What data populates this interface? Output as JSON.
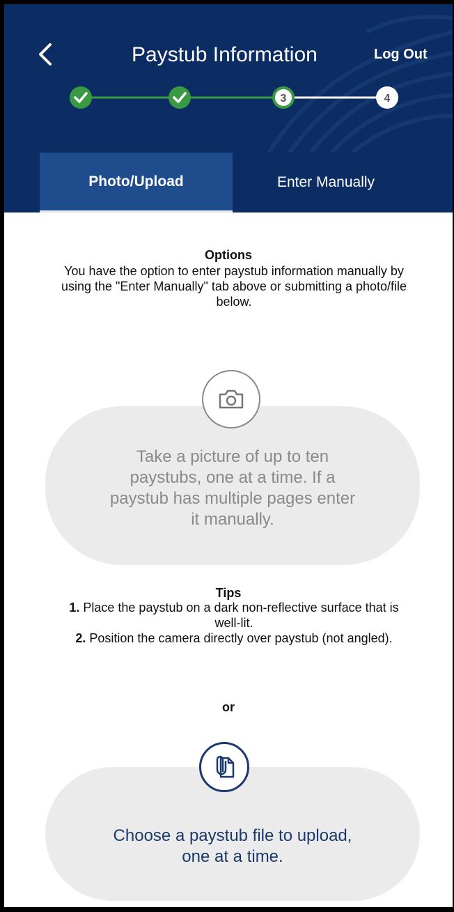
{
  "header": {
    "title": "Paystub Information",
    "logout_label": "Log Out",
    "back_icon": "chevron-left-icon"
  },
  "stepper": {
    "steps": [
      {
        "label": "",
        "status": "complete"
      },
      {
        "label": "",
        "status": "complete"
      },
      {
        "label": "3",
        "status": "current"
      },
      {
        "label": "4",
        "status": "upcoming"
      }
    ]
  },
  "tabs": [
    {
      "label": "Photo/Upload",
      "active": true
    },
    {
      "label": "Enter Manually",
      "active": false
    }
  ],
  "options": {
    "title": "Options",
    "text": "You have the option to enter paystub information manually by using the \"Enter Manually\" tab above or submitting a photo/file below."
  },
  "photo": {
    "icon": "camera-icon",
    "text": "Take a picture of up to ten paystubs, one at a time. If a paystub has multiple pages enter it manually."
  },
  "tips": {
    "title": "Tips",
    "items": [
      {
        "number": "1.",
        "text": " Place the paystub on a dark non-reflective surface that is well-lit."
      },
      {
        "number": "2.",
        "text": " Position the camera directly over paystub (not angled)."
      }
    ]
  },
  "or_label": "or",
  "upload": {
    "icon": "paperclip-file-icon",
    "text": "Choose a paystub file to upload, one at a time."
  },
  "colors": {
    "header_bg": "#0b2d63",
    "active_tab": "#1e4c8c",
    "step_complete": "#3a9a44",
    "upload_text": "#1b3a6b"
  }
}
